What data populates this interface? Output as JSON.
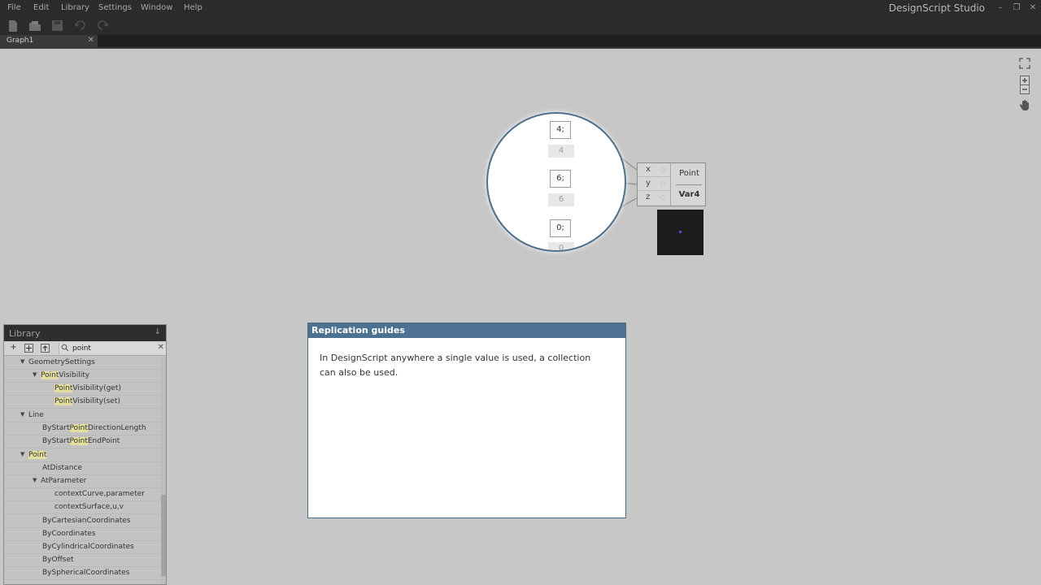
{
  "menubar": {
    "items": [
      "File",
      "Edit",
      "Library",
      "Settings",
      "Window",
      "Help"
    ],
    "app_title": "DesignScript Studio"
  },
  "toolbar": {
    "icons": [
      "new-file-icon",
      "open-icon",
      "save-icon",
      "undo-icon",
      "redo-icon"
    ]
  },
  "tabs": {
    "graph1": "Graph1"
  },
  "canvas": {
    "controls": [
      "fit-view-icon",
      "zoom-in-icon",
      "zoom-out-icon",
      "pan-hand-icon"
    ]
  },
  "magnifier": {
    "code_nodes": [
      {
        "code": "4;",
        "value": "4"
      },
      {
        "code": "6;",
        "value": "6"
      },
      {
        "code": "0;",
        "value": "0"
      }
    ]
  },
  "point_node": {
    "title": "Point",
    "variable": "Var4",
    "inputs": [
      "x",
      "y",
      "z"
    ]
  },
  "library": {
    "title": "Library",
    "search_value": "point",
    "tree": [
      {
        "pre": "",
        "hl": "",
        "post": "GeometrySettings"
      },
      {
        "pre": "",
        "hl": "Point",
        "post": "Visibility"
      },
      {
        "pre": "",
        "hl": "Point",
        "post": "Visibility(get)"
      },
      {
        "pre": "",
        "hl": "Point",
        "post": "Visibility(set)"
      },
      {
        "pre": "",
        "hl": "",
        "post": "Line"
      },
      {
        "pre": "ByStart",
        "hl": "Point",
        "post": "DirectionLength"
      },
      {
        "pre": "ByStart",
        "hl": "Point",
        "post": "EndPoint"
      },
      {
        "pre": "",
        "hl": "Point",
        "post": ""
      },
      {
        "pre": "",
        "hl": "",
        "post": "AtDistance"
      },
      {
        "pre": "",
        "hl": "",
        "post": "AtParameter"
      },
      {
        "pre": "",
        "hl": "",
        "post": "contextCurve,parameter"
      },
      {
        "pre": "",
        "hl": "",
        "post": "contextSurface,u,v"
      },
      {
        "pre": "",
        "hl": "",
        "post": "ByCartesianCoordinates"
      },
      {
        "pre": "",
        "hl": "",
        "post": "ByCoordinates"
      },
      {
        "pre": "",
        "hl": "",
        "post": "ByCylindricalCoordinates"
      },
      {
        "pre": "",
        "hl": "",
        "post": "ByOffset"
      },
      {
        "pre": "",
        "hl": "",
        "post": "BySphericalCoordinates"
      }
    ]
  },
  "tutorial": {
    "title": "Replication guides",
    "body": "In DesignScript anywhere a single value is used, a collection can also be used."
  }
}
